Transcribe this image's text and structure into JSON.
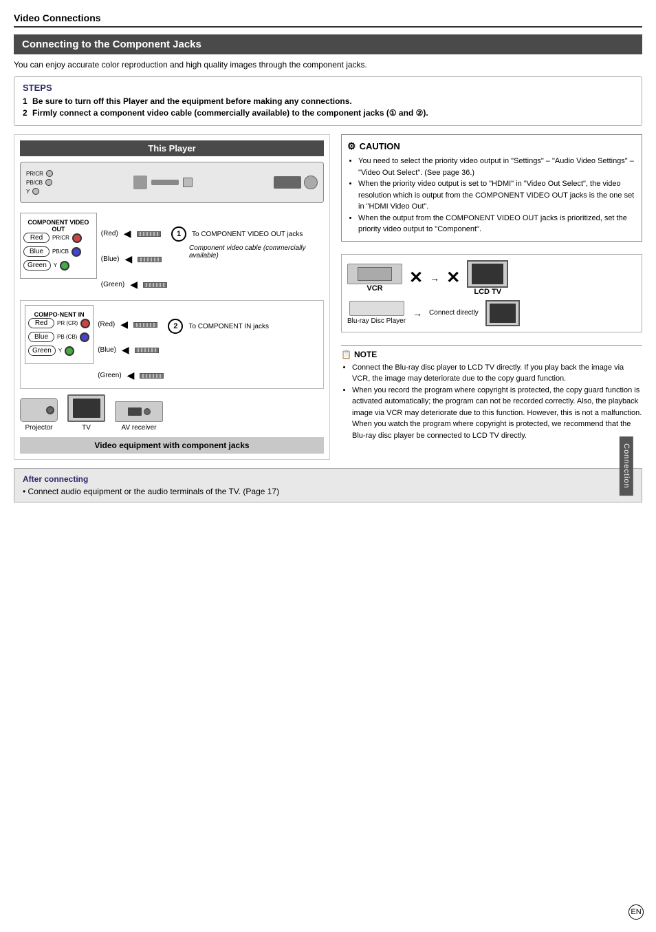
{
  "page": {
    "title": "Video Connections",
    "section_header": "Connecting to the Component Jacks",
    "intro": "You can enjoy accurate color reproduction and high quality images through the component jacks.",
    "steps": {
      "title": "STEPS",
      "items": [
        {
          "num": "1",
          "text": "Be sure to turn off this Player and the equipment before making any connections."
        },
        {
          "num": "2",
          "text": "Firmly connect a component video cable (commercially available) to the component jacks (① and ②)."
        }
      ]
    },
    "this_player_label": "This Player",
    "step1_label": "To COMPONENT VIDEO OUT jacks",
    "step2_label": "To COMPONENT IN jacks",
    "cable_label": "Component video cable (commercially available)",
    "output_jacks": {
      "section_label": "COMPONENT VIDEO OUT",
      "jacks": [
        {
          "color": "Red",
          "port_label": "PR/CR"
        },
        {
          "color": "Blue",
          "port_label": "PB/CB"
        },
        {
          "color": "Green",
          "port_label": "Y"
        }
      ],
      "color_labels": [
        "(Red)",
        "(Blue)",
        "(Green)"
      ]
    },
    "input_jacks": {
      "section_label": "COMPO-NENT IN",
      "jacks": [
        {
          "color": "Red",
          "port_label": "PR (CR)"
        },
        {
          "color": "Blue",
          "port_label": "PB (CB)"
        },
        {
          "color": "Green",
          "port_label": "Y"
        }
      ],
      "color_labels": [
        "(Red)",
        "(Blue)",
        "(Green)"
      ]
    },
    "video_equipment": {
      "bar_label": "Video equipment with component jacks",
      "items": [
        {
          "name": "Projector"
        },
        {
          "name": "TV"
        },
        {
          "name": "AV receiver"
        }
      ]
    },
    "caution": {
      "title": "CAUTION",
      "items": [
        "You need to select the priority video output in \"Settings\" – \"Audio Video Settings\" – \"Video Out Select\". (See page 36.)",
        "When the priority video output is set to \"HDMI\" in \"Video Out Select\", the video resolution which is output from the COMPONENT VIDEO OUT jacks is the one set in \"HDMI Video Out\".",
        "When the output from the COMPONENT VIDEO OUT jacks is prioritized, set the priority video output to \"Component\"."
      ]
    },
    "vcr_label": "VCR",
    "bd_player_label": "Blu-ray Disc Player",
    "lcd_tv_label": "LCD TV",
    "connect_directly_label": "Connect directly",
    "note": {
      "title": "NOTE",
      "items": [
        "Connect the Blu-ray disc player to LCD TV directly. If you play back the image via VCR, the image may deteriorate due to the copy guard function.",
        "When you record the program where copyright is protected, the copy guard function is activated automatically; the program can not be recorded correctly. Also, the playback image via VCR may deteriorate due to this function. However, this is not a malfunction. When you watch the program where copyright is protected, we recommend that the Blu-ray disc player be connected to LCD TV directly."
      ]
    },
    "after_connecting": {
      "title": "After connecting",
      "text": "• Connect audio equipment or the audio terminals of the TV. (Page 17)"
    },
    "en_badge": "EN",
    "sidebar_label": "Connection"
  }
}
